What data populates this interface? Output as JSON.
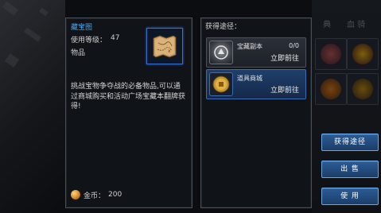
{
  "background_tabs": [
    "典",
    "血  骑"
  ],
  "item_detail": {
    "name": "藏宝图",
    "level_label": "使用等级：",
    "level_value": "47",
    "type": "物品",
    "icon": "treasure-map-icon",
    "description": "挑战宝物争夺战的必备物品,可以通过商城购买和活动广场宝藏本翻牌获得!",
    "price_icon": "gold-coin-icon",
    "price_label": "金币：",
    "price_value": "200"
  },
  "sources": {
    "title": "获得途径：",
    "items": [
      {
        "icon": "dungeon-emblem-icon",
        "name": "宝藏副本",
        "count": "0/0",
        "action": "立即前往"
      },
      {
        "icon": "mall-coin-icon",
        "name": "道具商城",
        "action": "立即前往"
      }
    ]
  },
  "side_buttons": {
    "obtain": "获得途径",
    "sell": "出  售",
    "use": "使  用"
  },
  "colors": {
    "accent_blue": "#4aa3e6",
    "button_blue": "#2c5c93",
    "panel_border": "#4a4f57"
  }
}
